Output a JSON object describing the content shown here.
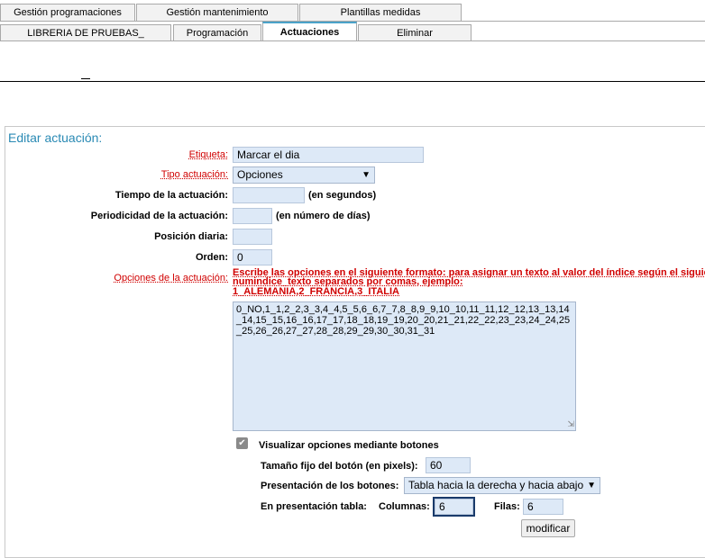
{
  "tabs_row1": [
    "Gestión programaciones",
    "Gestión mantenimiento",
    "Plantillas medidas"
  ],
  "tabs_row2": [
    "LIBRERIA DE PRUEBAS_",
    "Programación",
    "Actuaciones",
    "Eliminar"
  ],
  "panel_title": "Editar actuación:",
  "form": {
    "etiqueta_label": "Etiqueta:",
    "etiqueta_value": "Marcar el dia",
    "tipo_label": "Tipo actuación:",
    "tipo_value": "Opciones",
    "tiempo_label": "Tiempo de la actuación:",
    "tiempo_value": "",
    "tiempo_unit": "(en segundos)",
    "periodicidad_label": "Periodicidad de la actuación:",
    "periodicidad_value": "",
    "periodicidad_unit": "(en número de días)",
    "posicion_label": "Posición diaria:",
    "posicion_value": "",
    "orden_label": "Orden:",
    "orden_value": "0",
    "opciones_label": "Opciones de la actuación:",
    "opciones_help_1": "Escribe las opciones en el siguiente formato: para asignar un texto al valor del índice según el siguiente",
    "opciones_help_2": "numindice_texto separados por comas, ejemplo:",
    "opciones_help_3": "1_ALEMANIA,2_FRANCIA,3_ITALIA",
    "opciones_value": "0_NO,1_1,2_2,3_3,4_4,5_5,6_6,7_7,8_8,9_9,10_10,11_11,12_12,13_13,14_14,15_15,16_16,17_17,18_18,19_19,20_20,21_21,22_22,23_23,24_24,25_25,26_26,27_27,28_28,29_29,30_30,31_31",
    "botones_checked": true,
    "botones_label": "Visualizar opciones mediante botones",
    "tamano_label": "Tamaño fijo del botón (en pixels):",
    "tamano_value": "60",
    "presentacion_label": "Presentación de los botones:",
    "presentacion_value": "Tabla hacia la derecha y hacia abajo",
    "tabla_label": "En presentación tabla:",
    "columnas_label": "Columnas:",
    "columnas_value": "6",
    "filas_label": "Filas:",
    "filas_value": "6",
    "submit_label": "modificar"
  },
  "colors": {
    "accent": "#2a8ab4",
    "required": "#d00000",
    "field_bg": "#dde9f7"
  }
}
